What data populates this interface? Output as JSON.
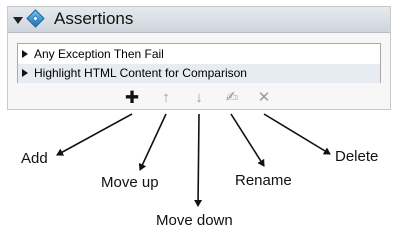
{
  "panel": {
    "title": "Assertions",
    "items": [
      {
        "label": "Any Exception Then Fail"
      },
      {
        "label": "Highlight HTML Content for Comparison"
      }
    ]
  },
  "toolbar": {
    "add_glyph": "✚",
    "move_up_glyph": "↑",
    "move_down_glyph": "↓",
    "rename_glyph": "✍",
    "delete_glyph": "✕"
  },
  "callouts": {
    "add": "Add",
    "move_up": "Move up",
    "move_down": "Move down",
    "rename": "Rename",
    "delete": "Delete"
  }
}
